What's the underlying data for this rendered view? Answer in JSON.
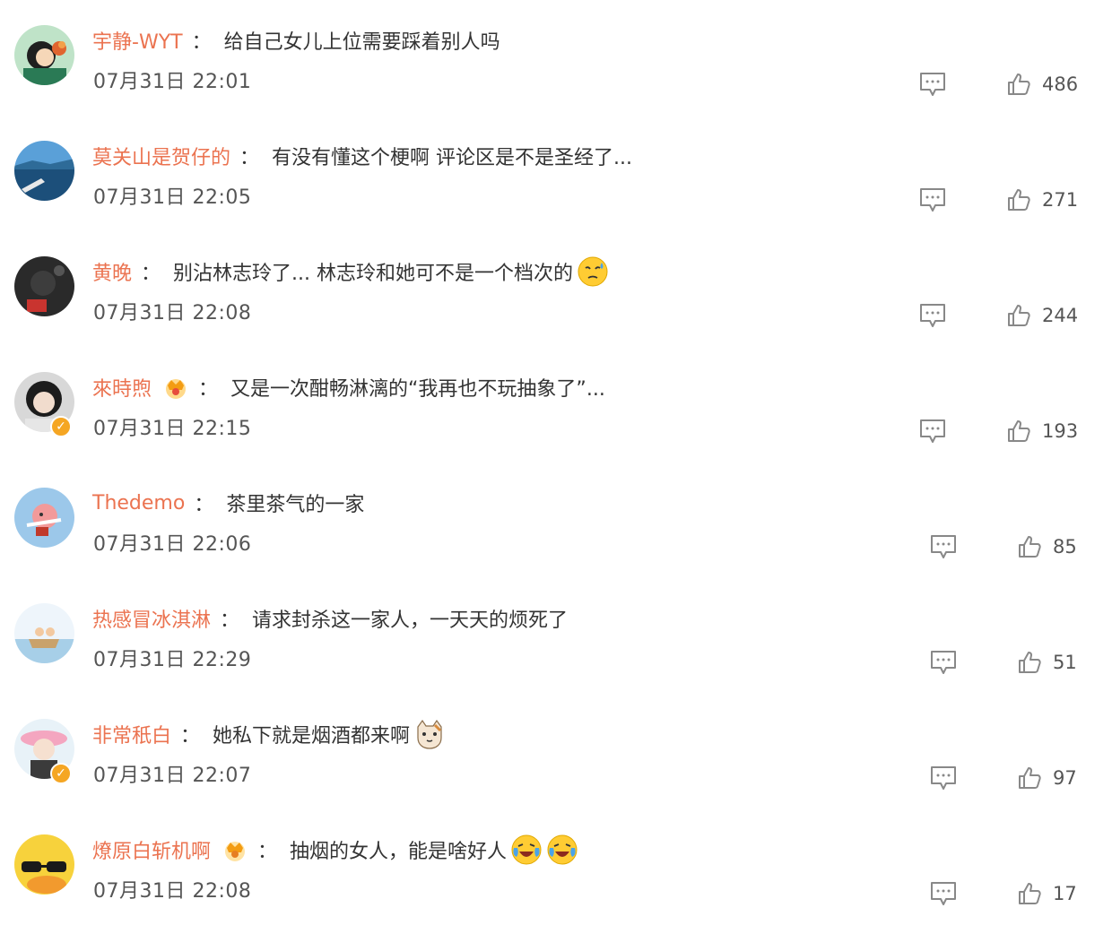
{
  "comments": [
    {
      "username": "宇静-WYT",
      "colon": "：",
      "text": "给自己女儿上位需要踩着别人吗",
      "time": "07月31日 22:01",
      "likes": "486",
      "avatar_icon": "girl-with-bird-avatar",
      "verified": false,
      "crown": false,
      "emojis": []
    },
    {
      "username": "莫关山是贺仔的",
      "colon": "：",
      "text": "有没有懂这个梗啊 评论区是不是圣经了...",
      "time": "07月31日 22:05",
      "likes": "271",
      "avatar_icon": "sea-landscape-avatar",
      "verified": false,
      "crown": false,
      "emojis": []
    },
    {
      "username": "黄晚",
      "colon": "：",
      "text": "别沾林志玲了... 林志玲和她可不是一个档次的",
      "time": "07月31日 22:08",
      "likes": "244",
      "avatar_icon": "dark-portrait-avatar",
      "verified": false,
      "crown": false,
      "emojis": [
        "sweat-face-emoji"
      ]
    },
    {
      "username": "來時煦",
      "colon": "：",
      "text": "又是一次酣畅淋漓的“我再也不玩抽象了”...",
      "time": "07月31日 22:15",
      "likes": "193",
      "avatar_icon": "girl-portrait-avatar",
      "verified": true,
      "crown": true,
      "emojis": []
    },
    {
      "username": "Thedemo",
      "colon": "：",
      "text": "茶里茶气的一家",
      "time": "07月31日 22:06",
      "likes": "85",
      "avatar_icon": "flying-pig-avatar",
      "verified": false,
      "crown": false,
      "emojis": []
    },
    {
      "username": "热感冒冰淇淋",
      "colon": "：",
      "text": "请求封杀这一家人，一天天的烦死了",
      "time": "07月31日 22:29",
      "likes": "51",
      "avatar_icon": "boat-illustration-avatar",
      "verified": false,
      "crown": false,
      "emojis": []
    },
    {
      "username": "非常秖白",
      "colon": "：",
      "text": "她私下就是烟酒都来啊",
      "time": "07月31日 22:07",
      "likes": "97",
      "avatar_icon": "girl-hat-avatar",
      "verified": true,
      "crown": false,
      "emojis": [
        "cat-emoji"
      ]
    },
    {
      "username": "燎原白斩机啊",
      "colon": "：",
      "text": "抽烟的女人，能是啥好人",
      "time": "07月31日 22:08",
      "likes": "17",
      "avatar_icon": "duck-sunglasses-avatar",
      "verified": false,
      "crown": true,
      "emojis": [
        "laugh-cry-emoji",
        "laugh-cry-emoji"
      ]
    }
  ],
  "colors": {
    "username": "#eb7350",
    "text": "#333333",
    "meta": "#555555",
    "icon": "#888888",
    "badge": "#f5a623"
  }
}
